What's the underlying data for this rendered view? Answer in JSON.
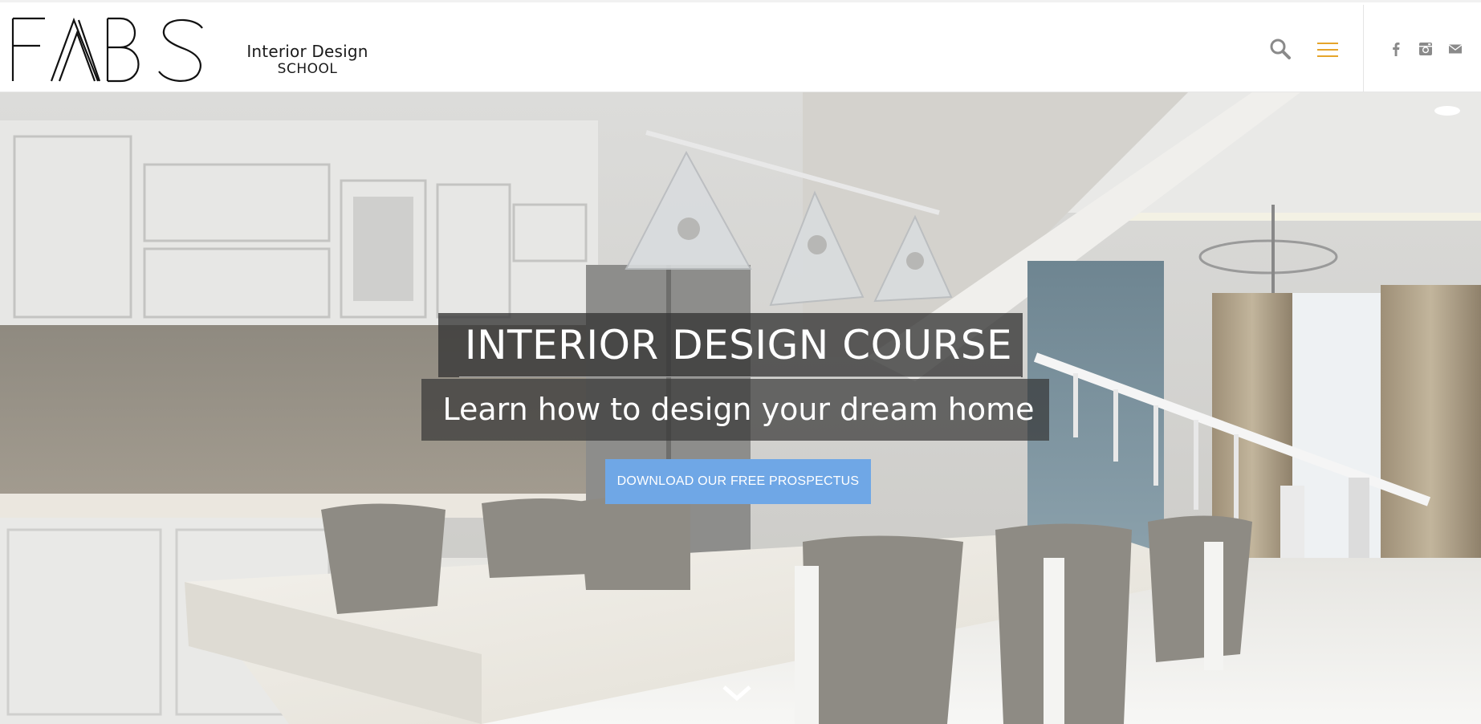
{
  "brand": {
    "logo_text": "FABS",
    "tagline_line1": "Interior Design",
    "tagline_line2": "SCHOOL"
  },
  "header": {
    "icons": {
      "search": "search-icon",
      "menu": "hamburger-menu-icon",
      "facebook": "facebook-icon",
      "instagram": "instagram-icon",
      "mail": "mail-icon"
    },
    "colors": {
      "menu_icon": "#e5a52b",
      "icon_gray": "#8a8a8a"
    }
  },
  "hero": {
    "title": "INTERIOR DESIGN COURSE",
    "subtitle": "Learn how to design your dream home",
    "cta_label": "DOWNLOAD OUR FREE PROSPECTUS",
    "scroll_icon": "chevron-down-icon",
    "colors": {
      "cta_background": "#6fa7e6",
      "overlay": "#343434"
    }
  }
}
